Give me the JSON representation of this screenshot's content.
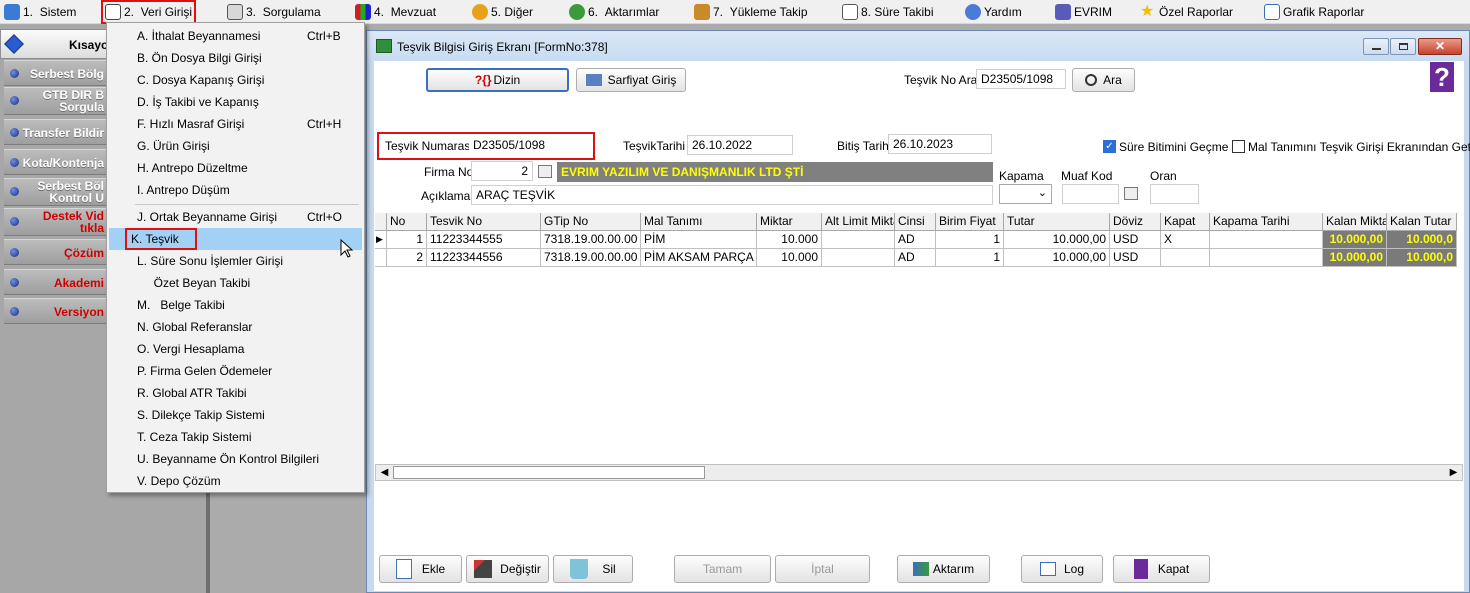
{
  "menubar": {
    "items": [
      {
        "num": "1.",
        "label": "Sistem"
      },
      {
        "num": "2.",
        "label": "Veri Girişi"
      },
      {
        "num": "3.",
        "label": "Sorgulama"
      },
      {
        "num": "4.",
        "label": "Mevzuat"
      },
      {
        "num": "5.",
        "label": "Diğer"
      },
      {
        "num": "6.",
        "label": "Aktarımlar"
      },
      {
        "num": "7.",
        "label": "Yükleme Takip"
      },
      {
        "num": "8.",
        "label": "Süre Takibi"
      },
      {
        "num": "",
        "label": "Yardım"
      },
      {
        "num": "",
        "label": "EVRIM"
      },
      {
        "num": "",
        "label": "Özel Raporlar"
      },
      {
        "num": "",
        "label": "Grafik Raporlar"
      }
    ]
  },
  "sidebar": {
    "header": "Kısayo",
    "items": [
      {
        "label": "Serbest Bölg"
      },
      {
        "label1": "GTB DIR B",
        "label2": "Sorgula"
      },
      {
        "label": "Transfer Bildir"
      },
      {
        "label": "Kota/Kontenja"
      },
      {
        "label1": "Serbest Böl",
        "label2": "Kontrol U"
      },
      {
        "label1": "Destek Vid",
        "label2": "tıkla"
      },
      {
        "label": "Çözüm"
      },
      {
        "label": "Akademi"
      },
      {
        "label": "Versiyon"
      }
    ]
  },
  "dropdown": {
    "items": [
      {
        "label": "A.  İthalat Beyannamesi",
        "shortcut": "Ctrl+B"
      },
      {
        "label": "B.  Ön Dosya Bilgi Girişi",
        "shortcut": ""
      },
      {
        "label": "C.  Dosya Kapanış Girişi",
        "shortcut": ""
      },
      {
        "label": "D.  İş Takibi ve Kapanış",
        "shortcut": ""
      },
      {
        "label": "F.  Hızlı Masraf Girişi",
        "shortcut": "Ctrl+H"
      },
      {
        "label": "G.  Ürün Girişi",
        "shortcut": ""
      },
      {
        "label": "H.  Antrepo Düzeltme",
        "shortcut": ""
      },
      {
        "label": "I.  Antrepo Düşüm",
        "shortcut": ""
      },
      {
        "label": "J.  Ortak Beyanname Girişi",
        "shortcut": "Ctrl+O"
      },
      {
        "label": "K.  Teşvik",
        "shortcut": ""
      },
      {
        "label": "L.  Süre Sonu İşlemler Girişi",
        "shortcut": ""
      },
      {
        "label": "     Özet Beyan Takibi",
        "shortcut": ""
      },
      {
        "label": "M.   Belge Takibi",
        "shortcut": ""
      },
      {
        "label": "N.  Global Referanslar",
        "shortcut": ""
      },
      {
        "label": "O. Vergi Hesaplama",
        "shortcut": ""
      },
      {
        "label": "P. Firma Gelen Ödemeler",
        "shortcut": ""
      },
      {
        "label": "R. Global ATR Takibi",
        "shortcut": ""
      },
      {
        "label": "S. Dilekçe Takip Sistemi",
        "shortcut": ""
      },
      {
        "label": "T. Ceza Takip Sistemi",
        "shortcut": ""
      },
      {
        "label": "U. Beyanname Ön Kontrol Bilgileri",
        "shortcut": ""
      },
      {
        "label": "V. Depo Çözüm",
        "shortcut": ""
      }
    ]
  },
  "window": {
    "title": "Teşvik Bilgisi Giriş Ekranı [FormNo:378]",
    "toolbar": {
      "dizin": "Dizin",
      "sarfiyat": "Sarfiyat Giriş",
      "tesvik_no_ara_label": "Teşvik No Ara",
      "tesvik_no_ara_value": "D23505/1098",
      "ara": "Ara",
      "help": "?"
    },
    "form": {
      "tesvik_numarasi_label": "Teşvik Numarası",
      "tesvik_numarasi_value": "D23505/1098",
      "tesvik_tarihi_label": "TeşvikTarihi",
      "tesvik_tarihi_value": "26.10.2022",
      "bitis_tarihi_label": "Bitiş Tarihi",
      "bitis_tarihi_value": "26.10.2023",
      "sure_bitimi_label": "Süre Bitimini Geçme",
      "mal_tanimi_label": "Mal Tanımını Teşvik Girişi Ekranından Getir",
      "firma_no_label": "Firma No",
      "firma_no_value": "2",
      "firma_name": "EVRIM YAZILIM VE DANIŞMANLIK LTD ŞTİ",
      "aciklama_label": "Açıklama",
      "aciklama_value": "ARAÇ TEŞVİK",
      "kapama_label": "Kapama",
      "muaf_kod_label": "Muaf Kod",
      "oran_label": "Oran"
    },
    "grid": {
      "headers": [
        "No",
        "Tesvik No",
        "GTip No",
        "Mal Tanımı",
        "Miktar",
        "Alt Limit Miktar",
        "Cinsi",
        "Birim Fiyat",
        "Tutar",
        "Döviz",
        "Kapat",
        "Kapama Tarihi",
        "Kalan Miktar",
        "Kalan Tutar"
      ],
      "rows": [
        [
          "1",
          "11223344555",
          "7318.19.00.00.00",
          "PİM",
          "10.000",
          "",
          "AD",
          "1",
          "10.000,00",
          "USD",
          "X",
          "",
          "10.000,00",
          "10.000,0"
        ],
        [
          "2",
          "11223344556",
          "7318.19.00.00.00",
          "PİM AKSAM PARÇA",
          "10.000",
          "",
          "AD",
          "1",
          "10.000,00",
          "USD",
          "",
          "",
          "10.000,00",
          "10.000,0"
        ]
      ]
    },
    "buttons": {
      "ekle": "Ekle",
      "degistir": "Değiştir",
      "sil": "Sil",
      "tamam": "Tamam",
      "iptal": "İptal",
      "aktarim": "Aktarım",
      "log": "Log",
      "kapat": "Kapat"
    }
  }
}
